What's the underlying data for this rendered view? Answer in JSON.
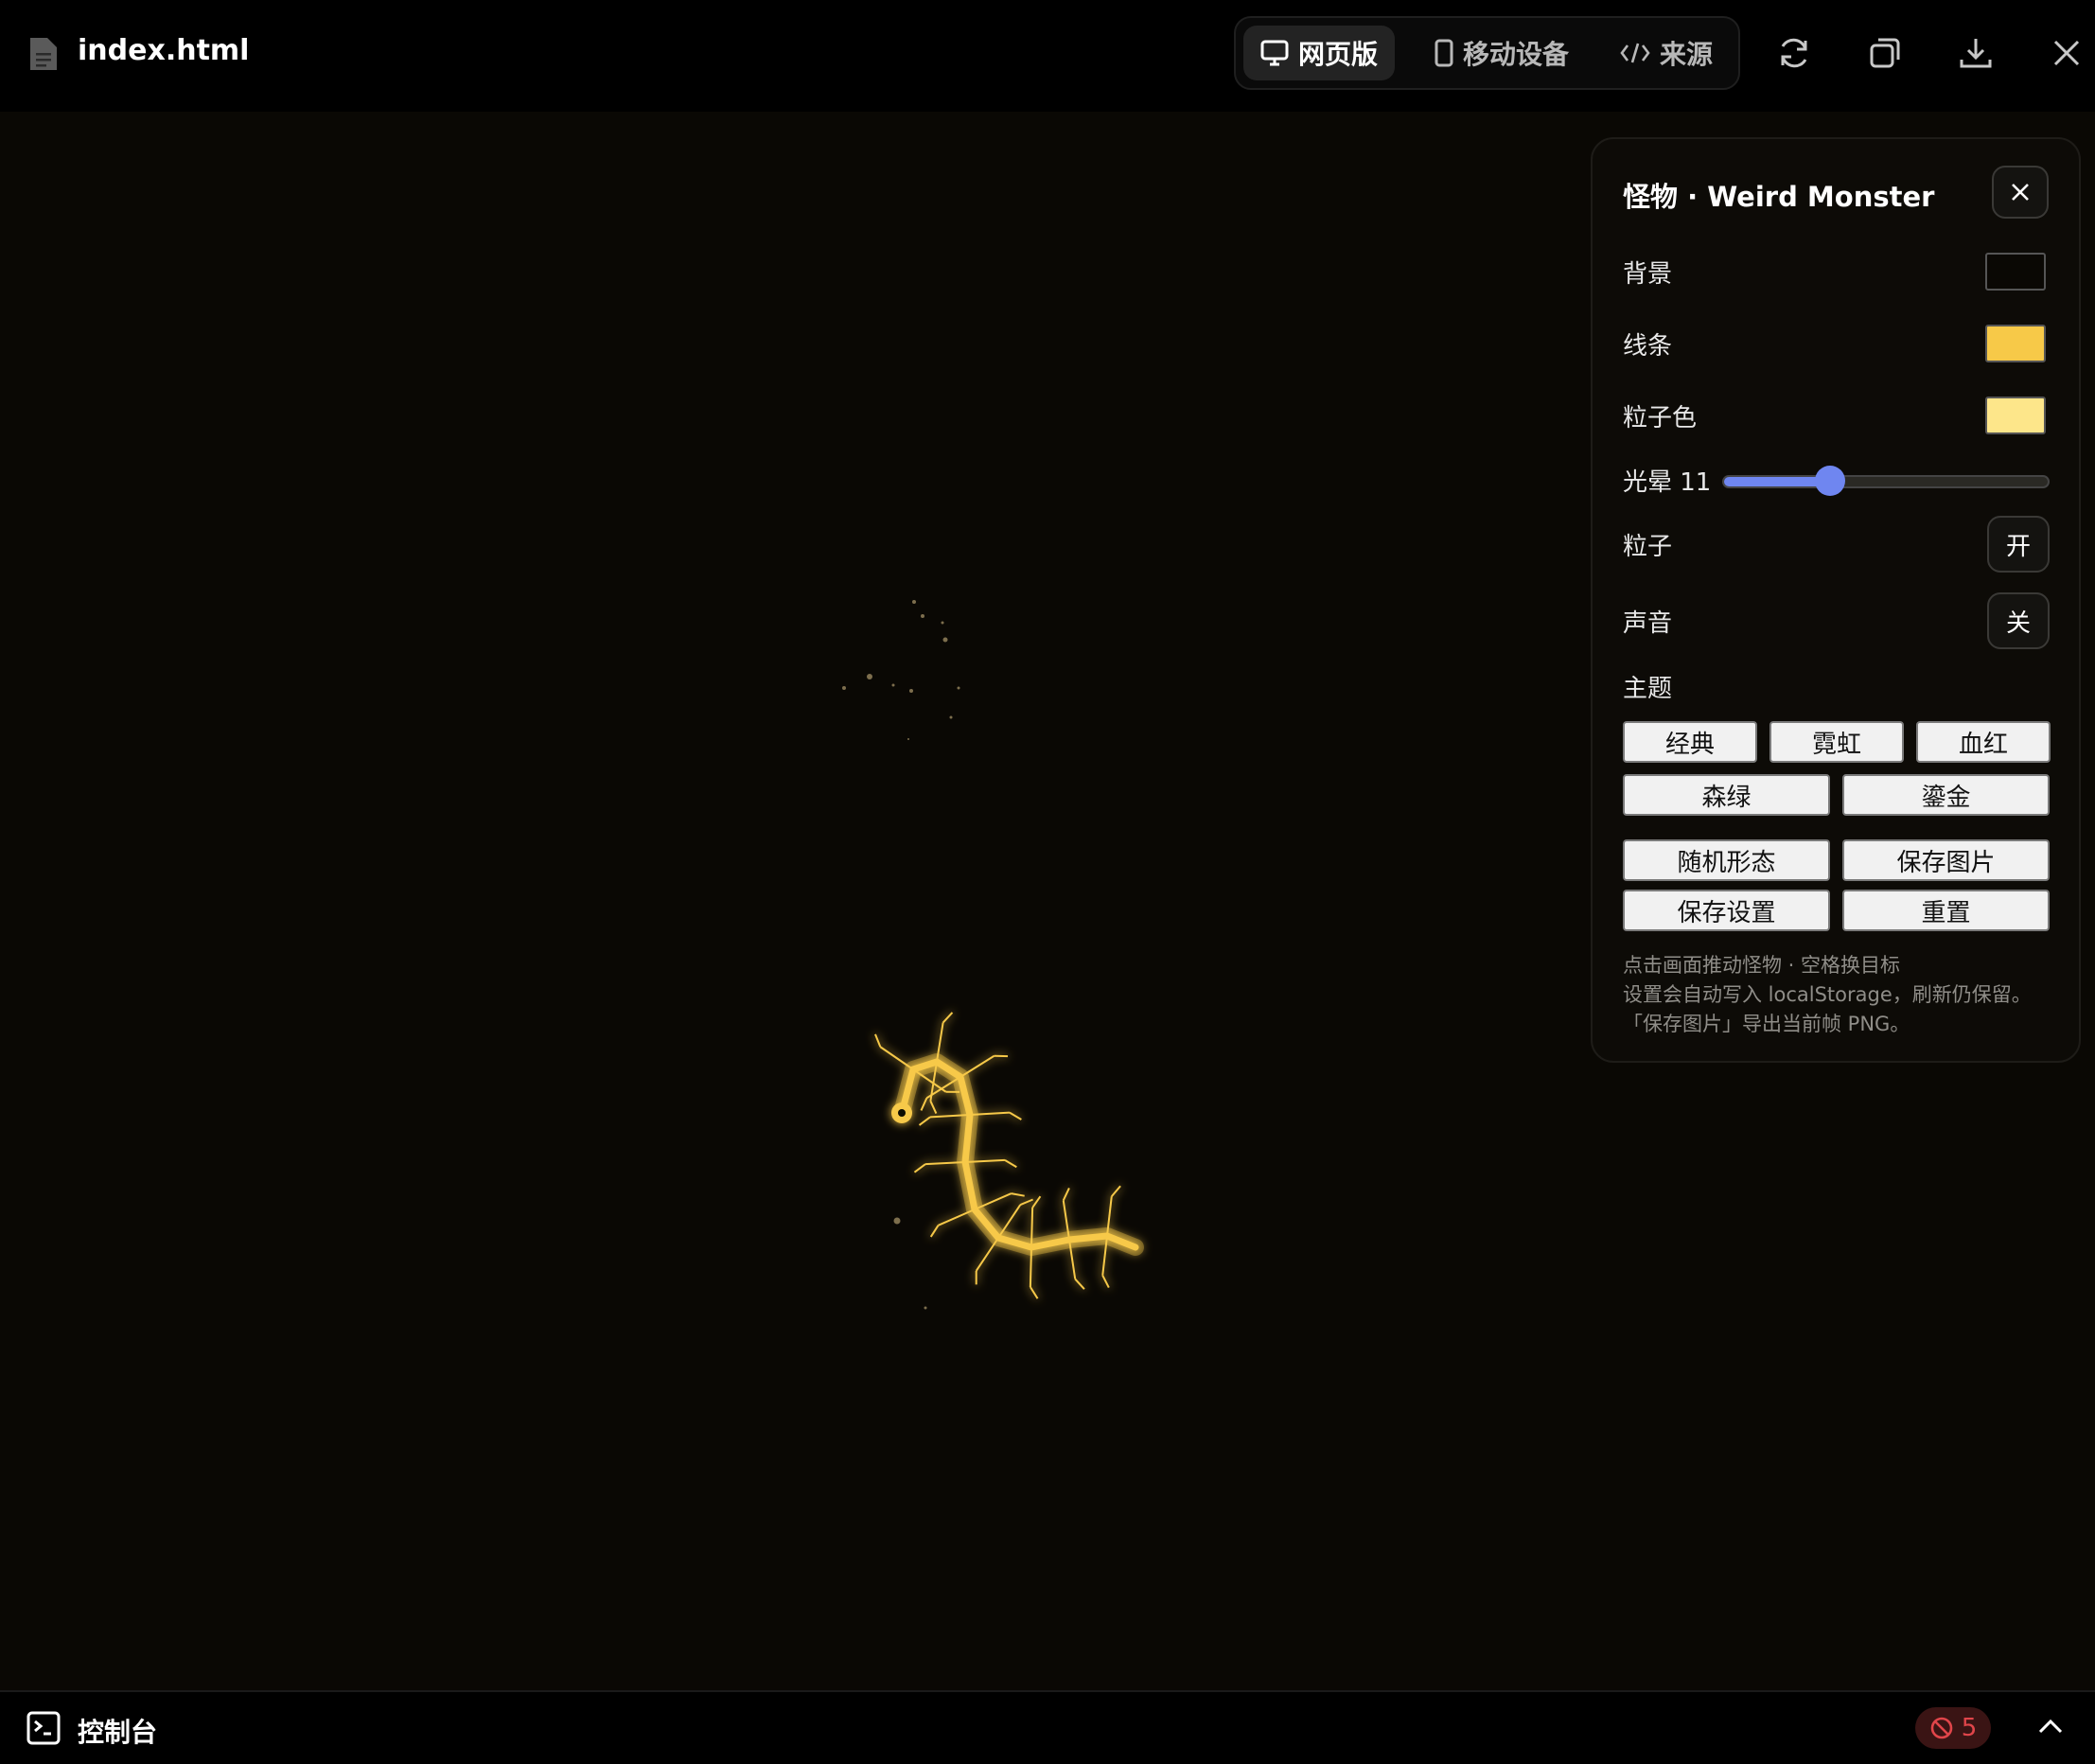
{
  "window": {
    "file_name": "index.html",
    "view_tabs": [
      {
        "label": "网页版",
        "icon": "monitor-icon",
        "active": true
      },
      {
        "label": "移动设备",
        "icon": "phone-icon",
        "active": false
      },
      {
        "label": "来源",
        "icon": "code-icon",
        "active": false
      }
    ],
    "toolbar_icons": [
      "refresh-icon",
      "copy-icon",
      "download-icon",
      "close-icon"
    ]
  },
  "panel": {
    "title": "怪物 · Weird Monster",
    "background_label": "背景",
    "background_color": "#0a0804",
    "line_label": "线条",
    "line_color": "#f7c948",
    "particle_color_label": "粒子色",
    "particle_color": "#fde68a",
    "glow_label": "光晕 11",
    "glow_value": 11,
    "glow_fraction": 0.33,
    "particles_label": "粒子",
    "particles_toggle": "开",
    "sound_label": "声音",
    "sound_toggle": "关",
    "theme_label": "主题",
    "themes": [
      "经典",
      "霓虹",
      "血红",
      "森绿",
      "鎏金"
    ],
    "actions": {
      "random": "随机形态",
      "save_image": "保存图片",
      "save_settings": "保存设置",
      "reset": "重置"
    },
    "hints": [
      "点击画面推动怪物 · 空格换目标",
      "设置会自动写入 localStorage，刷新仍保留。",
      "「保存图片」导出当前帧 PNG。"
    ]
  },
  "console": {
    "label": "控制台",
    "error_count": "5"
  },
  "colors": {
    "accent": "#6f86f0",
    "error": "#e0454a",
    "monster": "#f7c948"
  }
}
